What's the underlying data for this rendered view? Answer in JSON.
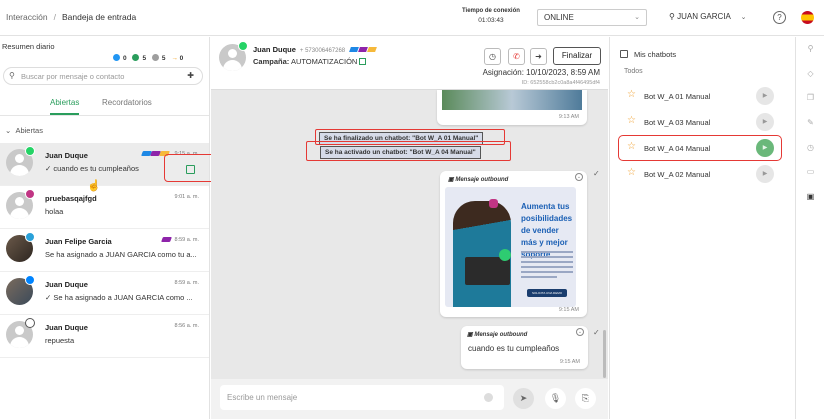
{
  "breadcrumb": {
    "root": "Interacción",
    "current": "Bandeja de entrada"
  },
  "connection": {
    "label": "Tiempo de conexión",
    "time": "01:03:43"
  },
  "status": {
    "value": "ONLINE"
  },
  "user": {
    "name": "JUAN GARCIA"
  },
  "left": {
    "resumen": "Resumen diario",
    "counts": [
      {
        "value": "0",
        "color": "#2196f3"
      },
      {
        "value": "5",
        "color": "#2a9d5c"
      },
      {
        "value": "5",
        "color": "#9e9e9e"
      },
      {
        "value": "0",
        "color": "#f39c12",
        "arrow": "→"
      }
    ],
    "search_placeholder": "Buscar por mensaje o contacto",
    "tabs": {
      "open": "Abiertas",
      "reminders": "Recordatorios"
    },
    "section": "Abiertas",
    "conversations": [
      {
        "name": "Juan Duque",
        "message": "cuando es tu cumpleaños",
        "time": "9:15 a. m.",
        "check": "✓",
        "channel_color": "#25d366"
      },
      {
        "name": "pruebasqajfgd",
        "message": "holaa",
        "time": "9:01 a. m.",
        "check": "",
        "channel_color": "#c13584"
      },
      {
        "name": "Juan Felipe Garcia",
        "message": "Se ha asignado a JUAN GARCIA como tu a...",
        "time": "8:59 a. m.",
        "check": "",
        "channel_color": "#2aa1d9"
      },
      {
        "name": "Juan Duque",
        "message": "Se ha asignado a JUAN GARCIA como ...",
        "time": "8:59 a. m.",
        "check": "✓",
        "channel_color": "#0084ff"
      },
      {
        "name": "Juan Duque",
        "message": "repuesta",
        "time": "8:56 a. m.",
        "check": "",
        "channel_color": "#555555"
      }
    ]
  },
  "chat": {
    "contact_name": "Juan Duque",
    "contact_phone": "+ 573006467268",
    "campaign_label": "Campaña:",
    "campaign_value": "AUTOMATIZACIÓN",
    "finish_button": "Finalizar",
    "assignment": "Asignación: 10/10/2023, 8:59 AM",
    "id_line": "ID: 652558cb2c0a8a4f46495df4",
    "messages": {
      "top_time": "9:13 AM",
      "sys_finished": "Se ha finalizado un chatbot: \"Bot W_A 01 Manual\"",
      "sys_activated": "Se ha activado un chatbot: \"Bot W_A 04 Manual\"",
      "outbound_label": "Mensaje outbound",
      "promo_headline": "Aumenta tus posibilidades de vender más y mejor soporte",
      "promo_cta": "SOLICITA UNA DEMO",
      "outbound_time_1": "9:15 AM",
      "outbound_text": "cuando es tu  cumpleaños",
      "outbound_time_2": "9:15 AM"
    },
    "input_placeholder": "Escribe un mensaje"
  },
  "bots": {
    "title": "Mis chatbots",
    "filter": "Todos",
    "items": [
      {
        "name": "Bot W_A 01 Manual",
        "active": false
      },
      {
        "name": "Bot W_A 03 Manual",
        "active": false
      },
      {
        "name": "Bot W_A 04 Manual",
        "active": true
      },
      {
        "name": "Bot W_A 02 Manual",
        "active": false
      }
    ]
  },
  "rail_icons": [
    "user-icon",
    "tag-icon",
    "copy-icon",
    "edit-icon",
    "clock-icon",
    "bookmark-icon",
    "bot-icon"
  ]
}
